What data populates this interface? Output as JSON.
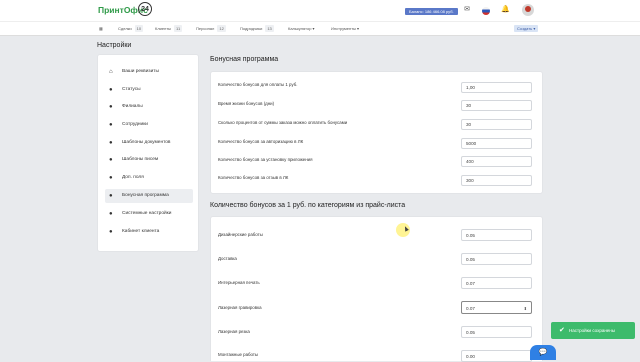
{
  "app": {
    "logo_text": "ПринтОфис",
    "logo_badge": "24"
  },
  "header": {
    "balance": "Баланс: 186 466.08 руб."
  },
  "nav": {
    "items": [
      {
        "label": "Сделки",
        "count": "10"
      },
      {
        "label": "Клиенты",
        "count": "11"
      },
      {
        "label": "Персонал",
        "count": "12"
      },
      {
        "label": "Подрядчики",
        "count": "13"
      },
      {
        "label": "Калькулятор ▾",
        "count": ""
      },
      {
        "label": "Инструменты ▾",
        "count": ""
      }
    ],
    "create_label": "Создать ▾"
  },
  "page": {
    "title": "Настройки"
  },
  "sidebar": {
    "items": [
      {
        "label": "Ваши реквизиты",
        "icon": "home-icon"
      },
      {
        "label": "Статусы",
        "icon": "user-icon"
      },
      {
        "label": "Филиалы",
        "icon": "user-icon"
      },
      {
        "label": "Сотрудники",
        "icon": "user-icon"
      },
      {
        "label": "Шаблоны документов",
        "icon": "user-icon"
      },
      {
        "label": "Шаблоны писем",
        "icon": "user-icon"
      },
      {
        "label": "Доп. поля",
        "icon": "user-icon"
      },
      {
        "label": "Бонусная программа",
        "icon": "user-icon"
      },
      {
        "label": "Системные настройки",
        "icon": "user-icon"
      },
      {
        "label": "Кабинет клиента",
        "icon": "user-icon"
      }
    ]
  },
  "bonus": {
    "title": "Бонусная программа",
    "rows": [
      {
        "label": "Количество бонусов для оплаты 1 руб.",
        "value": "1,00"
      },
      {
        "label": "Время жизни бонусов (дни)",
        "value": "30"
      },
      {
        "label": "Сколько процентов от суммы заказа можно оплатить бонусами",
        "value": "30"
      },
      {
        "label": "Количество бонусов за авторизацию в ЛК",
        "value": "5000"
      },
      {
        "label": "Количество бонусов за установку приложения",
        "value": "400"
      },
      {
        "label": "Количество бонусов за отзыв в ЛК",
        "value": "300"
      }
    ]
  },
  "pricelist": {
    "title": "Количество бонусов за 1 руб. по категориям из прайс-листа",
    "rows": [
      {
        "label": "Дизайнерские работы",
        "value": "0.05"
      },
      {
        "label": "Доставка",
        "value": "0.05"
      },
      {
        "label": "Интерьерная печать",
        "value": "0.07"
      },
      {
        "label": "Лазерная гравировка",
        "value": "0.07"
      },
      {
        "label": "Лазерная резка",
        "value": "0.05"
      },
      {
        "label": "Монтажные работы",
        "value": "0.00"
      }
    ]
  },
  "toast": {
    "message": "Настройки сохранены"
  }
}
